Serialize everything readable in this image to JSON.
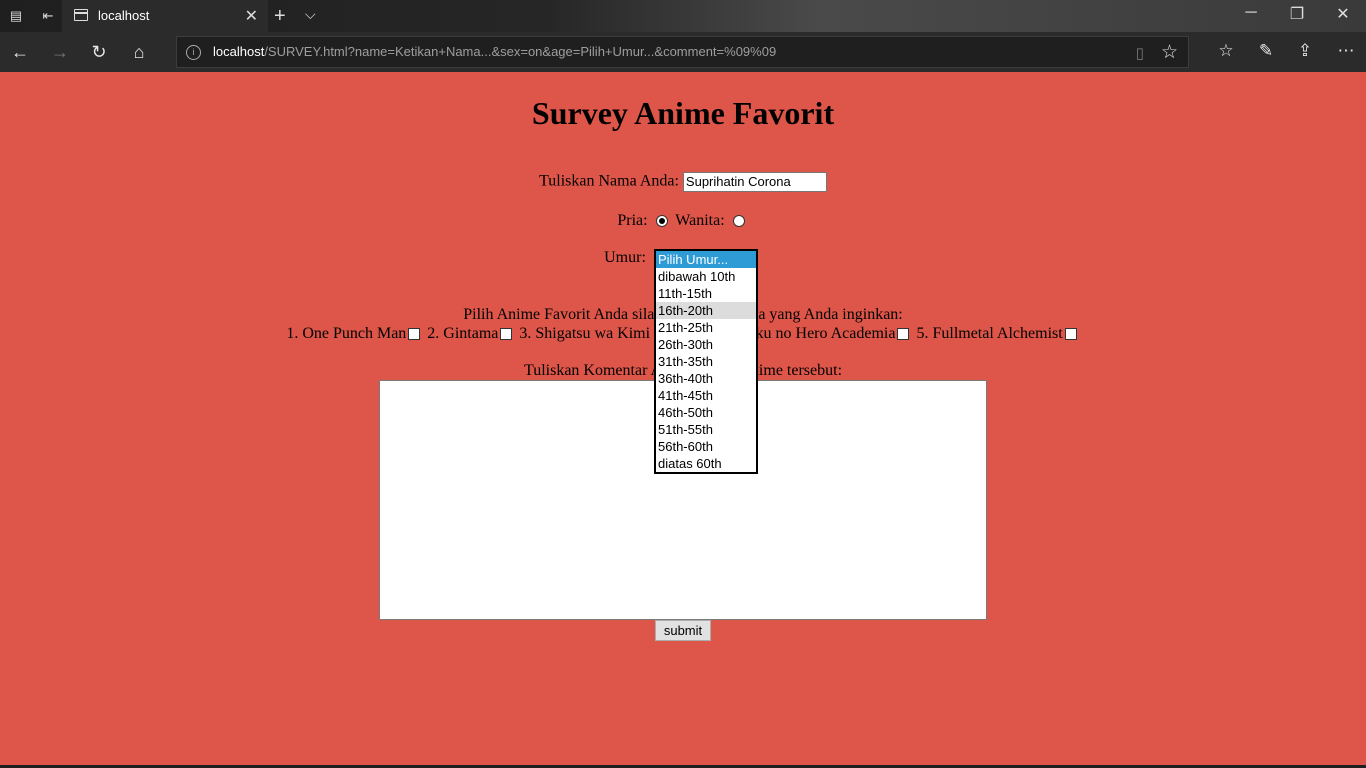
{
  "browser": {
    "tab_title": "localhost",
    "url_host": "localhost",
    "url_rest": "/SURVEY.html?name=Ketikan+Nama...&sex=on&age=Pilih+Umur...&comment=%09%09",
    "tab_close_glyph": "✕",
    "new_tab_glyph": "+",
    "tab_list_glyph": "⌵",
    "minimize_glyph": "─",
    "restore_glyph": "❐",
    "close_glyph": "✕",
    "back_glyph": "←",
    "forward_glyph": "→",
    "refresh_glyph": "↻",
    "home_glyph": "⌂",
    "favorites_bar_glyph": "☆",
    "pen_glyph": "✎",
    "share_glyph": "⇪",
    "more_glyph": "⋯"
  },
  "page": {
    "title": "Survey Anime Favorit",
    "name_label": "Tuliskan Nama Anda:",
    "name_value": "Suprihatin Corona",
    "pria_label": "Pria:",
    "wanita_label": "Wanita:",
    "umur_label": "Umur:",
    "anime_prompt": "Pilih Anime Favorit Anda silahkan pilih berapa yang Anda inginkan:",
    "anime": [
      "1. One Punch Man",
      "2. Gintama",
      "3. Shigatsu wa Kimi no Uso",
      "4. Boku no Hero Academia",
      "5. Fullmetal Alchemist"
    ],
    "comment_label": "Tuliskan Komentar Anda tentang Anime tersebut:",
    "submit_label": "submit"
  },
  "age_options": [
    "Pilih Umur...",
    "dibawah 10th",
    "11th-15th",
    "16th-20th",
    "21th-25th",
    "26th-30th",
    "31th-35th",
    "36th-40th",
    "41th-45th",
    "46th-50th",
    "51th-55th",
    "56th-60th",
    "diatas 60th"
  ],
  "colors": {
    "page_background": "#de5549",
    "selected_option": "#2e9bd6",
    "hover_option": "#dcdcdc"
  }
}
